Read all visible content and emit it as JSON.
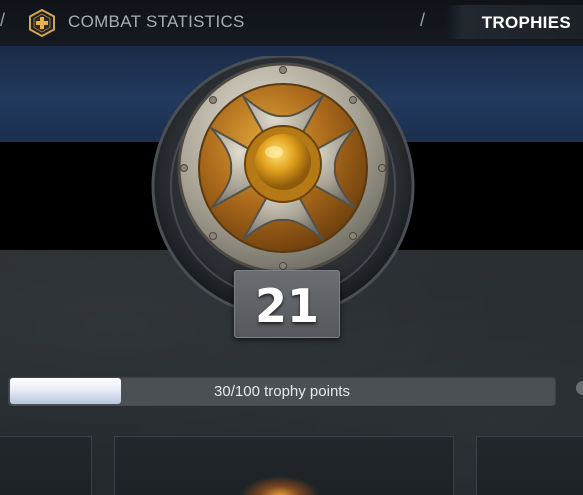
{
  "nav": {
    "separator": "/",
    "combat_label": "COMBAT STATISTICS",
    "trophies_label": "TROPHIES"
  },
  "trophy": {
    "level": "21",
    "progress_text": "30/100 trophy points",
    "progress_fraction": 0.3
  },
  "colors": {
    "hero_band": "#223a5e",
    "badge_gold": "#e2a43a",
    "progress_fill": "#e8edf6"
  },
  "icons": {
    "nav_badge": "plus-hexagon-icon",
    "emblem": "round-shield-emblem"
  }
}
